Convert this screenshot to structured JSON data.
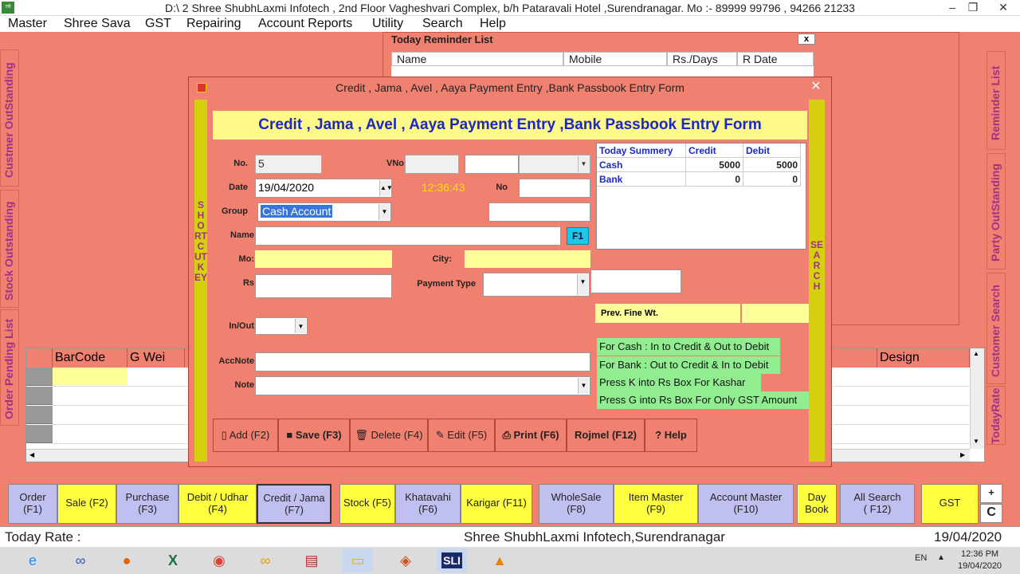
{
  "window": {
    "title": "D:\\  2 Shree ShubhLaxmi Infotech  , 2nd Floor Vagheshvari Complex, b/h Pataravali Hotel ,Surendranagar. Mo :- 89999 99796 , 94266 21233"
  },
  "menu": [
    "Master",
    "Shree Sava",
    "GST",
    "Repairing",
    "Account Reports",
    "Utility",
    "Search",
    "Help"
  ],
  "left_tabs": [
    "Custmer OutStanding",
    "Stock Outstanding",
    "Order Pending List"
  ],
  "right_tabs": [
    "Reminder List",
    "Party OutStanding",
    "Customer Search",
    "TodayRate"
  ],
  "reminder": {
    "title": "Today Reminder List",
    "close": "x",
    "headers": [
      "Name",
      "Mobile",
      "Rs./Days",
      "R Date"
    ]
  },
  "grid": {
    "headers": [
      "BarCode",
      "G Wei",
      "Design"
    ]
  },
  "dialog": {
    "caption": "Credit , Jama , Avel , Aaya Payment Entry ,Bank Passbook  Entry Form",
    "banner": "Credit , Jama , Avel , Aaya Payment Entry ,Bank Passbook  Entry Form",
    "close": "✕",
    "shortcut_key": "SHORTCUT KEY",
    "search": "SEARCH",
    "labels": {
      "no": "No.",
      "vno": "VNo",
      "date": "Date",
      "no2": "No",
      "group": "Group",
      "name": "Name",
      "mo": "Mo:",
      "city": "City:",
      "rs": "Rs",
      "payment_type": "Payment Type",
      "inout": "In/Out",
      "prev_fine": "Prev. Fine Wt.",
      "accnote": "AccNote",
      "note": "Note"
    },
    "values": {
      "no": "5",
      "date": "19/04/2020",
      "time": "12:36:43",
      "group": "Cash Account",
      "f1": "F1"
    },
    "summary": {
      "headers": [
        "Today Summery",
        "Credit",
        "Debit"
      ],
      "rows": [
        {
          "label": "Cash",
          "credit": "5000",
          "debit": "5000"
        },
        {
          "label": "Bank",
          "credit": "0",
          "debit": "0"
        }
      ]
    },
    "hints": [
      "For Cash : In to Credit  &  Out to Debit",
      "For Bank : Out to Credit  &  In to Debit",
      "Press K   into Rs Box  For Kashar",
      "Press G into Rs Box  For  Only GST Amount"
    ],
    "buttons": [
      "Add (F2)",
      "Save (F3)",
      "Delete (F4)",
      "Edit (F5)",
      "Print (F6)",
      "Rojmel (F12)",
      "Help"
    ]
  },
  "fbuttons": [
    {
      "l1": "Order",
      "l2": "(F1)"
    },
    {
      "l1": "Sale (F2)",
      "l2": ""
    },
    {
      "l1": "Purchase",
      "l2": "(F3)"
    },
    {
      "l1": "Debit / Udhar",
      "l2": "(F4)"
    },
    {
      "l1": "Credit / Jama",
      "l2": "(F7)"
    },
    {
      "l1": "Stock (F5)",
      "l2": ""
    },
    {
      "l1": "Khatavahi",
      "l2": "(F6)"
    },
    {
      "l1": "Karigar (F11)",
      "l2": ""
    },
    {
      "l1": "WholeSale",
      "l2": "(F8)"
    },
    {
      "l1": "Item Master",
      "l2": "(F9)"
    },
    {
      "l1": "Account Master",
      "l2": "(F10)"
    },
    {
      "l1": "Day",
      "l2": "Book"
    },
    {
      "l1": "All Search",
      "l2": "( F12)"
    },
    {
      "l1": "GST",
      "l2": ""
    },
    {
      "l1": "+",
      "l2": ""
    },
    {
      "l1": "C",
      "l2": ""
    }
  ],
  "status": {
    "left": "Today Rate :",
    "center": "Shree ShubhLaxmi Infotech,Surendranagar",
    "right": "19/04/2020"
  },
  "taskbar": {
    "lang": "EN",
    "time": "12:36 PM",
    "date": "19/04/2020",
    "sli": "SLI"
  }
}
